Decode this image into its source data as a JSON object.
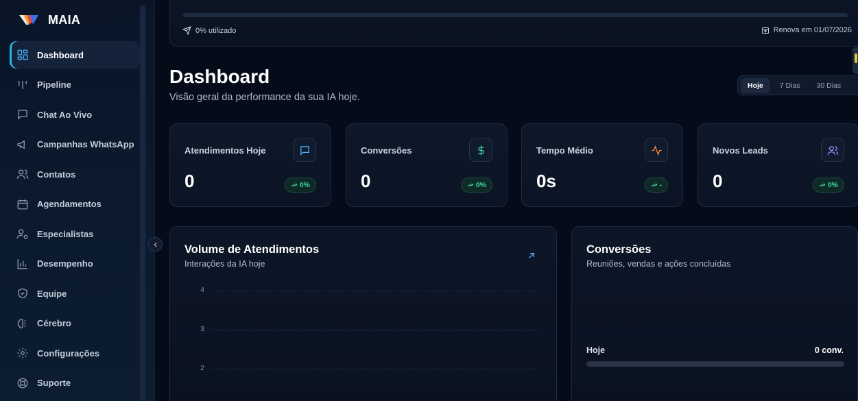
{
  "brand": {
    "name": "MAIA"
  },
  "sidebar": {
    "items": [
      {
        "label": "Dashboard",
        "icon": "dashboard-icon",
        "active": true
      },
      {
        "label": "Pipeline",
        "icon": "pipeline-icon"
      },
      {
        "label": "Chat Ao Vivo",
        "icon": "chat-icon"
      },
      {
        "label": "Campanhas WhatsApp",
        "icon": "megaphone-icon"
      },
      {
        "label": "Contatos",
        "icon": "users-icon"
      },
      {
        "label": "Agendamentos",
        "icon": "calendar-icon"
      },
      {
        "label": "Especialistas",
        "icon": "user-cog-icon"
      },
      {
        "label": "Desempenho",
        "icon": "bar-chart-icon"
      },
      {
        "label": "Equipe",
        "icon": "shield-icon"
      },
      {
        "label": "Cérebro",
        "icon": "brain-icon"
      },
      {
        "label": "Configurações",
        "icon": "gear-icon"
      },
      {
        "label": "Suporte",
        "icon": "lifebuoy-icon"
      }
    ]
  },
  "usage": {
    "used_label": "0% utilizado",
    "used_fraction": 0,
    "renew_label": "Renova em 01/07/2026"
  },
  "header": {
    "title": "Dashboard",
    "subtitle": "Visão geral da performance da sua IA hoje."
  },
  "range_tabs": [
    {
      "label": "Hoje",
      "active": true
    },
    {
      "label": "7 Dias"
    },
    {
      "label": "30 Dias"
    }
  ],
  "stats": [
    {
      "label": "Atendimentos Hoje",
      "value": "0",
      "badge": "0%",
      "icon": "message-square-icon",
      "icon_color": "#4fb3ff"
    },
    {
      "label": "Conversões",
      "value": "0",
      "badge": "0%",
      "icon": "dollar-icon",
      "icon_color": "#3fd6a2"
    },
    {
      "label": "Tempo Médio",
      "value": "0s",
      "badge": "-",
      "icon": "activity-icon",
      "icon_color": "#ff8a3d"
    },
    {
      "label": "Novos Leads",
      "value": "0",
      "badge": "0%",
      "icon": "users-icon",
      "icon_color": "#a78bfa"
    }
  ],
  "volume_panel": {
    "title": "Volume de Atendimentos",
    "subtitle": "Interações da IA hoje",
    "link_icon": "arrow-up-right-icon"
  },
  "chart_data": {
    "type": "line",
    "title": "Volume de Atendimentos",
    "subtitle": "Interações da IA hoje",
    "yticks": [
      4,
      3,
      2
    ],
    "ylim": [
      0,
      4
    ],
    "grid": true,
    "series": []
  },
  "conversions_panel": {
    "title": "Conversões",
    "subtitle": "Reuniões, vendas e ações concluídas",
    "row_label": "Hoje",
    "row_value": "0 conv.",
    "row_fraction": 0
  },
  "colors": {
    "accent": "#2fb6e0",
    "success": "#3fd6a2"
  }
}
